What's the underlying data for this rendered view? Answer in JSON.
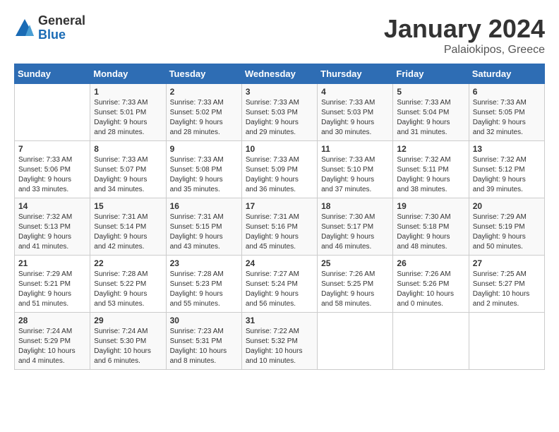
{
  "header": {
    "logo_general": "General",
    "logo_blue": "Blue",
    "title": "January 2024",
    "subtitle": "Palaiokipos, Greece"
  },
  "days_of_week": [
    "Sunday",
    "Monday",
    "Tuesday",
    "Wednesday",
    "Thursday",
    "Friday",
    "Saturday"
  ],
  "weeks": [
    [
      {
        "day": "",
        "info": ""
      },
      {
        "day": "1",
        "info": "Sunrise: 7:33 AM\nSunset: 5:01 PM\nDaylight: 9 hours\nand 28 minutes."
      },
      {
        "day": "2",
        "info": "Sunrise: 7:33 AM\nSunset: 5:02 PM\nDaylight: 9 hours\nand 28 minutes."
      },
      {
        "day": "3",
        "info": "Sunrise: 7:33 AM\nSunset: 5:03 PM\nDaylight: 9 hours\nand 29 minutes."
      },
      {
        "day": "4",
        "info": "Sunrise: 7:33 AM\nSunset: 5:03 PM\nDaylight: 9 hours\nand 30 minutes."
      },
      {
        "day": "5",
        "info": "Sunrise: 7:33 AM\nSunset: 5:04 PM\nDaylight: 9 hours\nand 31 minutes."
      },
      {
        "day": "6",
        "info": "Sunrise: 7:33 AM\nSunset: 5:05 PM\nDaylight: 9 hours\nand 32 minutes."
      }
    ],
    [
      {
        "day": "7",
        "info": "Sunrise: 7:33 AM\nSunset: 5:06 PM\nDaylight: 9 hours\nand 33 minutes."
      },
      {
        "day": "8",
        "info": "Sunrise: 7:33 AM\nSunset: 5:07 PM\nDaylight: 9 hours\nand 34 minutes."
      },
      {
        "day": "9",
        "info": "Sunrise: 7:33 AM\nSunset: 5:08 PM\nDaylight: 9 hours\nand 35 minutes."
      },
      {
        "day": "10",
        "info": "Sunrise: 7:33 AM\nSunset: 5:09 PM\nDaylight: 9 hours\nand 36 minutes."
      },
      {
        "day": "11",
        "info": "Sunrise: 7:33 AM\nSunset: 5:10 PM\nDaylight: 9 hours\nand 37 minutes."
      },
      {
        "day": "12",
        "info": "Sunrise: 7:32 AM\nSunset: 5:11 PM\nDaylight: 9 hours\nand 38 minutes."
      },
      {
        "day": "13",
        "info": "Sunrise: 7:32 AM\nSunset: 5:12 PM\nDaylight: 9 hours\nand 39 minutes."
      }
    ],
    [
      {
        "day": "14",
        "info": "Sunrise: 7:32 AM\nSunset: 5:13 PM\nDaylight: 9 hours\nand 41 minutes."
      },
      {
        "day": "15",
        "info": "Sunrise: 7:31 AM\nSunset: 5:14 PM\nDaylight: 9 hours\nand 42 minutes."
      },
      {
        "day": "16",
        "info": "Sunrise: 7:31 AM\nSunset: 5:15 PM\nDaylight: 9 hours\nand 43 minutes."
      },
      {
        "day": "17",
        "info": "Sunrise: 7:31 AM\nSunset: 5:16 PM\nDaylight: 9 hours\nand 45 minutes."
      },
      {
        "day": "18",
        "info": "Sunrise: 7:30 AM\nSunset: 5:17 PM\nDaylight: 9 hours\nand 46 minutes."
      },
      {
        "day": "19",
        "info": "Sunrise: 7:30 AM\nSunset: 5:18 PM\nDaylight: 9 hours\nand 48 minutes."
      },
      {
        "day": "20",
        "info": "Sunrise: 7:29 AM\nSunset: 5:19 PM\nDaylight: 9 hours\nand 50 minutes."
      }
    ],
    [
      {
        "day": "21",
        "info": "Sunrise: 7:29 AM\nSunset: 5:21 PM\nDaylight: 9 hours\nand 51 minutes."
      },
      {
        "day": "22",
        "info": "Sunrise: 7:28 AM\nSunset: 5:22 PM\nDaylight: 9 hours\nand 53 minutes."
      },
      {
        "day": "23",
        "info": "Sunrise: 7:28 AM\nSunset: 5:23 PM\nDaylight: 9 hours\nand 55 minutes."
      },
      {
        "day": "24",
        "info": "Sunrise: 7:27 AM\nSunset: 5:24 PM\nDaylight: 9 hours\nand 56 minutes."
      },
      {
        "day": "25",
        "info": "Sunrise: 7:26 AM\nSunset: 5:25 PM\nDaylight: 9 hours\nand 58 minutes."
      },
      {
        "day": "26",
        "info": "Sunrise: 7:26 AM\nSunset: 5:26 PM\nDaylight: 10 hours\nand 0 minutes."
      },
      {
        "day": "27",
        "info": "Sunrise: 7:25 AM\nSunset: 5:27 PM\nDaylight: 10 hours\nand 2 minutes."
      }
    ],
    [
      {
        "day": "28",
        "info": "Sunrise: 7:24 AM\nSunset: 5:29 PM\nDaylight: 10 hours\nand 4 minutes."
      },
      {
        "day": "29",
        "info": "Sunrise: 7:24 AM\nSunset: 5:30 PM\nDaylight: 10 hours\nand 6 minutes."
      },
      {
        "day": "30",
        "info": "Sunrise: 7:23 AM\nSunset: 5:31 PM\nDaylight: 10 hours\nand 8 minutes."
      },
      {
        "day": "31",
        "info": "Sunrise: 7:22 AM\nSunset: 5:32 PM\nDaylight: 10 hours\nand 10 minutes."
      },
      {
        "day": "",
        "info": ""
      },
      {
        "day": "",
        "info": ""
      },
      {
        "day": "",
        "info": ""
      }
    ]
  ]
}
